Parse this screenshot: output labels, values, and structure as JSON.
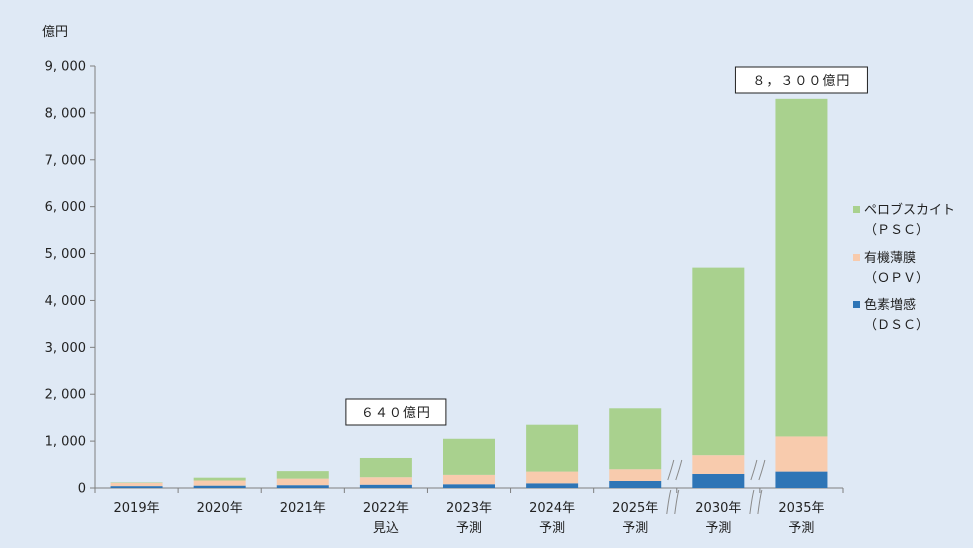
{
  "chart_data": {
    "type": "bar",
    "stacked": true,
    "unit": "億円",
    "categories": [
      [
        "2019年"
      ],
      [
        "2020年"
      ],
      [
        "2021年"
      ],
      [
        "2022年",
        "見込"
      ],
      [
        "2023年",
        "予測"
      ],
      [
        "2024年",
        "予測"
      ],
      [
        "2025年",
        "予測"
      ],
      [
        "2030年",
        "予測"
      ],
      [
        "2035年",
        "予測"
      ]
    ],
    "series": [
      {
        "name": "色素増感（DSC）",
        "legend_lines": [
          "色素増感",
          "（ＤＳＣ）"
        ],
        "color": "#2e75b6",
        "values": [
          40,
          50,
          60,
          70,
          80,
          100,
          150,
          300,
          350
        ]
      },
      {
        "name": "有機薄膜（OPV）",
        "legend_lines": [
          "有機薄膜",
          "（ＯＰＶ）"
        ],
        "color": "#f8cbad",
        "values": [
          70,
          110,
          140,
          160,
          200,
          250,
          250,
          400,
          750
        ]
      },
      {
        "name": "ペロブスカイト（PSC）",
        "legend_lines": [
          "ペロブスカイト",
          "（ＰＳＣ）"
        ],
        "color": "#a9d18e",
        "values": [
          10,
          60,
          160,
          410,
          770,
          1000,
          1300,
          4000,
          7200
        ]
      }
    ],
    "ylim": [
      0,
      9000
    ],
    "yticks": [
      "0",
      "1, 000",
      "2, 000",
      "3, 000",
      "4, 000",
      "5, 000",
      "6, 000",
      "7, 000",
      "8, 000",
      "9, 000"
    ],
    "ytick_values": [
      0,
      1000,
      2000,
      3000,
      4000,
      5000,
      6000,
      7000,
      8000,
      9000
    ],
    "annotations": [
      {
        "text": "６４０億円",
        "category_index": 3
      },
      {
        "text": "８，３００億円",
        "category_index": 8
      }
    ],
    "axis_breaks_before": [
      7,
      8
    ],
    "grid": false,
    "legend_position": "right"
  }
}
